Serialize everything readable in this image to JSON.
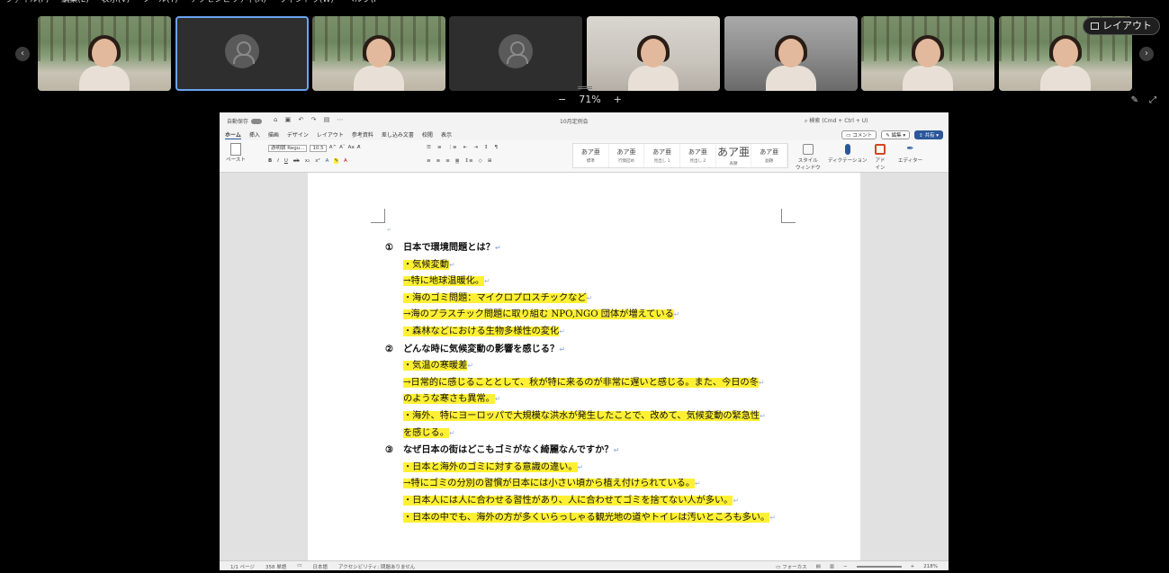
{
  "menubar": [
    "ファイル(F)",
    "編集(E)",
    "表示(V)",
    "ツール(T)",
    "アクセシビリティ(A)",
    "ウィンドウ(W)",
    "ヘルプ(H)"
  ],
  "layout_button": {
    "label": "レイアウト",
    "icon": "layout-icon"
  },
  "zoom": {
    "minus": "−",
    "value": "71%",
    "plus": "+"
  },
  "participants": [
    {
      "kind": "video",
      "bg": "forest"
    },
    {
      "kind": "avatar",
      "active": true
    },
    {
      "kind": "video",
      "bg": "forest"
    },
    {
      "kind": "avatar"
    },
    {
      "kind": "video",
      "bg": "room"
    },
    {
      "kind": "video",
      "bg": "office"
    },
    {
      "kind": "video",
      "bg": "forest"
    },
    {
      "kind": "video",
      "bg": "forest"
    }
  ],
  "word": {
    "autosave": "自動保存",
    "doc_title": "10月定例会",
    "search_placeholder": "検索 (Cmd + Ctrl + U)",
    "tabs": [
      "ホーム",
      "挿入",
      "描画",
      "デザイン",
      "レイアウト",
      "参考資料",
      "差し込み文書",
      "校閲",
      "表示"
    ],
    "comment_label": "コメント",
    "edit_label": "編集",
    "share_label": "共有",
    "font_name": "游明朝 Regu...",
    "font_size": "10.5",
    "paste_label": "ペースト",
    "styles": [
      {
        "sample": "あア亜",
        "name": "標準"
      },
      {
        "sample": "あア亜",
        "name": "行間詰め"
      },
      {
        "sample": "あア亜",
        "name": "見出し 1"
      },
      {
        "sample": "あア亜",
        "name": "見出し 2"
      },
      {
        "sample": "あア亜",
        "name": "表題"
      },
      {
        "sample": "あア亜",
        "name": "副題"
      }
    ],
    "style_window": "スタイル\nウィンドウ",
    "dictation": "ディクテーション",
    "addins": "アド\nイン",
    "editor": "エディター",
    "status": {
      "page": "1/1 ページ",
      "words": "358 単語",
      "lang": "日本語",
      "access": "アクセシビリティ: 問題ありません",
      "focus": "フォーカス",
      "zoom": "218%"
    }
  },
  "document": {
    "sections": [
      {
        "num": "①",
        "heading": "日本で環境問題とは？",
        "lines": [
          {
            "text": "・気候変動",
            "hl": true
          },
          {
            "text": "→特に地球温暖化。",
            "hl": true,
            "noindent": true
          },
          {
            "text": "・海のゴミ問題：マイクロプロスチックなど",
            "hl": true
          },
          {
            "text": "→海のプラスチック問題に取り組む NPO,NGO 団体が増えている",
            "hl": true,
            "noindent": true
          },
          {
            "text": "・森林などにおける生物多様性の変化",
            "hl": true
          }
        ]
      },
      {
        "num": "②",
        "heading": "どんな時に気候変動の影響を感じる？",
        "lines": [
          {
            "text": "・気温の寒暖差",
            "hl": true
          },
          {
            "text": "→日常的に感じることとして、秋が特に来るのが非常に遅いと感じる。また、今日の冬",
            "hl": true,
            "noindent": true
          },
          {
            "text": "のような寒さも異常。",
            "hl": true,
            "noindent": true
          },
          {
            "text": "・海外、特にヨーロッパで大規模な洪水が発生したことで、改めて、気候変動の緊急性",
            "hl": true
          },
          {
            "text": "を感じる。",
            "hl": true,
            "noindent": true
          }
        ]
      },
      {
        "num": "③",
        "heading": "なぜ日本の街はどこもゴミがなく綺麗なんですか？",
        "lines": [
          {
            "text": "・日本と海外のゴミに対する意識の違い。",
            "hl": true
          },
          {
            "text": "→特にゴミの分別の習慣が日本には小さい頃から植え付けられている。",
            "hl": true,
            "noindent": true
          },
          {
            "text": "・日本人には人に合わせる習性があり、人に合わせてゴミを捨てない人が多い。",
            "hl": true
          },
          {
            "text": "・日本の中でも、海外の方が多くいらっしゃる観光地の道やトイレは汚いところも多い。",
            "hl": true
          }
        ]
      }
    ]
  }
}
